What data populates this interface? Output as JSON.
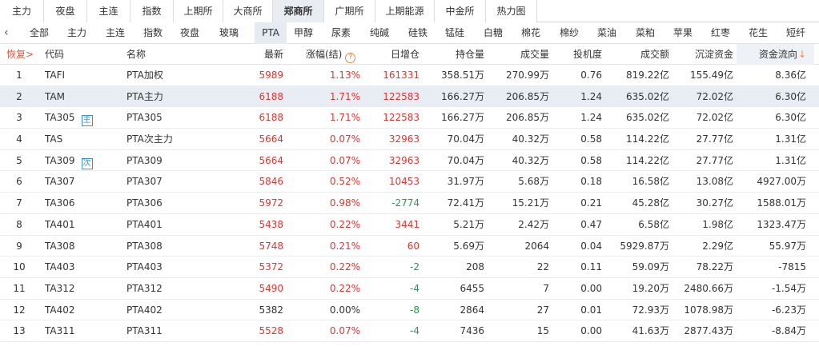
{
  "exchange_tabs": [
    {
      "label": "主力"
    },
    {
      "label": "夜盘"
    },
    {
      "label": "主连"
    },
    {
      "label": "指数"
    },
    {
      "label": "上期所"
    },
    {
      "label": "大商所"
    },
    {
      "label": "郑商所",
      "active": true
    },
    {
      "label": "广期所"
    },
    {
      "label": "上期能源"
    },
    {
      "label": "中金所"
    },
    {
      "label": "热力图"
    }
  ],
  "product_tabs": [
    {
      "label": "全部"
    },
    {
      "label": "主力"
    },
    {
      "label": "主连"
    },
    {
      "label": "指数"
    },
    {
      "label": "夜盘"
    },
    {
      "label": "玻璃"
    },
    {
      "label": "PTA",
      "active": true
    },
    {
      "label": "甲醇"
    },
    {
      "label": "尿素"
    },
    {
      "label": "纯碱"
    },
    {
      "label": "硅铁"
    },
    {
      "label": "锰硅"
    },
    {
      "label": "白糖"
    },
    {
      "label": "棉花"
    },
    {
      "label": "棉纱"
    },
    {
      "label": "菜油"
    },
    {
      "label": "菜粕"
    },
    {
      "label": "苹果"
    },
    {
      "label": "红枣"
    },
    {
      "label": "花生"
    },
    {
      "label": "短纤"
    }
  ],
  "table": {
    "headers": {
      "restore": "恢复>",
      "code": "代码",
      "name": "名称",
      "last": "最新",
      "change": "涨幅(结)",
      "daily_oi_change": "日增仓",
      "open_interest": "持仓量",
      "volume": "成交量",
      "speculation": "投机度",
      "turnover": "成交额",
      "settled_funds": "沉淀资金",
      "fund_flow": "资金流向"
    },
    "rows": [
      {
        "idx": "1",
        "code": "TAFI",
        "badge": "",
        "name": "PTA加权",
        "last": "5989",
        "change": "1.13%",
        "inc": "161331",
        "oi": "358.51万",
        "vol": "270.99万",
        "spec": "0.76",
        "amt": "819.22亿",
        "fund": "155.49亿",
        "flow": "8.36亿",
        "last_dir": "up",
        "chg_dir": "up",
        "inc_dir": "up"
      },
      {
        "idx": "2",
        "code": "TAM",
        "badge": "",
        "name": "PTA主力",
        "last": "6188",
        "change": "1.71%",
        "inc": "122583",
        "oi": "166.27万",
        "vol": "206.85万",
        "spec": "1.24",
        "amt": "635.02亿",
        "fund": "72.02亿",
        "flow": "6.30亿",
        "last_dir": "up",
        "chg_dir": "up",
        "inc_dir": "up",
        "selected": true
      },
      {
        "idx": "3",
        "code": "TA305",
        "badge": "主",
        "name": "PTA305",
        "last": "6188",
        "change": "1.71%",
        "inc": "122583",
        "oi": "166.27万",
        "vol": "206.85万",
        "spec": "1.24",
        "amt": "635.02亿",
        "fund": "72.02亿",
        "flow": "6.30亿",
        "last_dir": "up",
        "chg_dir": "up",
        "inc_dir": "up"
      },
      {
        "idx": "4",
        "code": "TAS",
        "badge": "",
        "name": "PTA次主力",
        "last": "5664",
        "change": "0.07%",
        "inc": "32963",
        "oi": "70.04万",
        "vol": "40.32万",
        "spec": "0.58",
        "amt": "114.22亿",
        "fund": "27.77亿",
        "flow": "1.31亿",
        "last_dir": "up",
        "chg_dir": "up",
        "inc_dir": "up"
      },
      {
        "idx": "5",
        "code": "TA309",
        "badge": "次",
        "name": "PTA309",
        "last": "5664",
        "change": "0.07%",
        "inc": "32963",
        "oi": "70.04万",
        "vol": "40.32万",
        "spec": "0.58",
        "amt": "114.22亿",
        "fund": "27.77亿",
        "flow": "1.31亿",
        "last_dir": "up",
        "chg_dir": "up",
        "inc_dir": "up"
      },
      {
        "idx": "6",
        "code": "TA307",
        "badge": "",
        "name": "PTA307",
        "last": "5846",
        "change": "0.52%",
        "inc": "10453",
        "oi": "31.97万",
        "vol": "5.68万",
        "spec": "0.18",
        "amt": "16.58亿",
        "fund": "13.08亿",
        "flow": "4927.00万",
        "last_dir": "up",
        "chg_dir": "up",
        "inc_dir": "up"
      },
      {
        "idx": "7",
        "code": "TA306",
        "badge": "",
        "name": "PTA306",
        "last": "5972",
        "change": "0.98%",
        "inc": "-2774",
        "oi": "72.41万",
        "vol": "15.21万",
        "spec": "0.21",
        "amt": "45.28亿",
        "fund": "30.27亿",
        "flow": "1588.01万",
        "last_dir": "up",
        "chg_dir": "up",
        "inc_dir": "down"
      },
      {
        "idx": "8",
        "code": "TA401",
        "badge": "",
        "name": "PTA401",
        "last": "5438",
        "change": "0.22%",
        "inc": "3441",
        "oi": "5.21万",
        "vol": "2.42万",
        "spec": "0.47",
        "amt": "6.58亿",
        "fund": "1.98亿",
        "flow": "1323.47万",
        "last_dir": "up",
        "chg_dir": "up",
        "inc_dir": "up"
      },
      {
        "idx": "9",
        "code": "TA308",
        "badge": "",
        "name": "PTA308",
        "last": "5748",
        "change": "0.21%",
        "inc": "60",
        "oi": "5.69万",
        "vol": "2064",
        "spec": "0.04",
        "amt": "5929.87万",
        "fund": "2.29亿",
        "flow": "55.97万",
        "last_dir": "up",
        "chg_dir": "up",
        "inc_dir": "up"
      },
      {
        "idx": "10",
        "code": "TA403",
        "badge": "",
        "name": "PTA403",
        "last": "5372",
        "change": "0.22%",
        "inc": "-2",
        "oi": "208",
        "vol": "22",
        "spec": "0.11",
        "amt": "59.09万",
        "fund": "78.22万",
        "flow": "-7815",
        "last_dir": "up",
        "chg_dir": "up",
        "inc_dir": "down"
      },
      {
        "idx": "11",
        "code": "TA312",
        "badge": "",
        "name": "PTA312",
        "last": "5490",
        "change": "0.22%",
        "inc": "-4",
        "oi": "6455",
        "vol": "7",
        "spec": "0.00",
        "amt": "19.20万",
        "fund": "2480.66万",
        "flow": "-1.54万",
        "last_dir": "up",
        "chg_dir": "up",
        "inc_dir": "down"
      },
      {
        "idx": "12",
        "code": "TA402",
        "badge": "",
        "name": "PTA402",
        "last": "5382",
        "change": "0.00%",
        "inc": "-8",
        "oi": "2864",
        "vol": "27",
        "spec": "0.01",
        "amt": "72.93万",
        "fund": "1078.98万",
        "flow": "-6.23万",
        "last_dir": "flat",
        "chg_dir": "flat",
        "inc_dir": "down"
      },
      {
        "idx": "13",
        "code": "TA311",
        "badge": "",
        "name": "PTA311",
        "last": "5528",
        "change": "0.07%",
        "inc": "-4",
        "oi": "7436",
        "vol": "15",
        "spec": "0.00",
        "amt": "41.63万",
        "fund": "2877.43万",
        "flow": "-8.84万",
        "last_dir": "up",
        "chg_dir": "up",
        "inc_dir": "down"
      }
    ]
  },
  "colors": {
    "up": "#e8322e",
    "down": "#1f9e4b",
    "accent": "#f0883e",
    "selected_row": "#e8ecf3"
  },
  "icons": {
    "back": "chevron-left-icon",
    "help": "question-circle-icon",
    "sort": "arrow-down-icon"
  }
}
